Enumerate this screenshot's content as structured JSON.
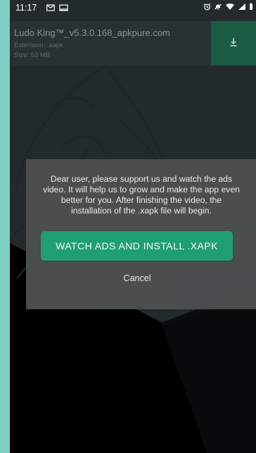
{
  "status_bar": {
    "time": "11:17",
    "left_icons": [
      "mail-icon",
      "screen-icon"
    ],
    "right_icons": [
      "alarm-icon",
      "do-not-disturb-icon",
      "wifi-icon",
      "signal-icon",
      "battery-icon"
    ]
  },
  "file_card": {
    "filename": "Ludo King™_v5.3.0.168_apkpure.com",
    "extension": "Extension: .xapk",
    "size": "Size: 53 MB",
    "download_icon": "download-icon"
  },
  "dialog": {
    "message": "Dear user, please support us and watch the ads video. It will help us to grow and make the app even better for you. After finishing the video, the installation of the .xapk file will begin.",
    "primary_button_label": "WATCH ADS AND INSTALL .XAPK",
    "cancel_label": "Cancel"
  },
  "colors": {
    "accent": "#1fa176",
    "dialog_background": "#4b4f4e",
    "screen_background": "#232a2c",
    "outer_background": "#7fcfc3"
  }
}
